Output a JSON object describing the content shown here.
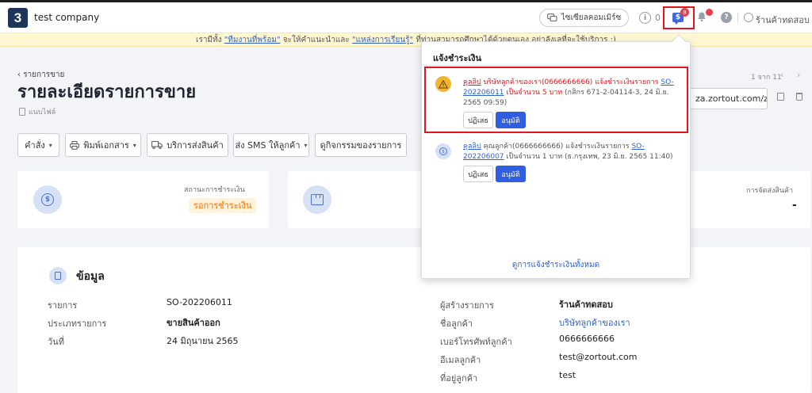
{
  "navbar": {
    "logo_letter": "3",
    "company_name": "test company",
    "consult_label": "ไซเซียลคอมเมิร์ซ",
    "info_count": "0",
    "payment_badge_count": "8",
    "user_name": "ร้านค้าทดสอบ"
  },
  "announcement": {
    "prefix": "เรามีทั้ง ",
    "link1": "\"ทีมงานที่พร้อม\"",
    "middle": " จะให้คำแนะนำและ ",
    "link2": "\"แหล่งการเรียนรู้\"",
    "suffix": " ที่ท่านสามารถศึกษาได้ด้วยตนเอง อย่าลังเลที่จะใช้บริการ :)"
  },
  "page": {
    "breadcrumb": "รายการขาย",
    "title": "รายละเอียดรายการขาย",
    "attach_label": "แนบไฟล์",
    "pager": "1 จาก 11",
    "share_link": "za.zortout.com/zo2"
  },
  "toolbar": {
    "command": "คำสั่ง",
    "print": "พิมพ์เอกสาร",
    "shipping": "บริการส่งสินค้า",
    "sms": "ส่ง SMS ให้ลูกค้า",
    "activity": "ดูกิจกรรมของรายการ"
  },
  "status_cards": {
    "payment_label": "สถานะการชำระเงิน",
    "payment_status": "รอการชำระเงิน",
    "shipping_label": "การจัดส่งสินค้า",
    "shipping_value": "-"
  },
  "info": {
    "title": "ข้อมูล",
    "left": [
      {
        "label": "รายการ",
        "value": "SO-202206011"
      },
      {
        "label": "ประเภทรายการ",
        "value": "ขายสินค้าออก"
      },
      {
        "label": "วันที่",
        "value": "24 มิถุนายน 2565"
      }
    ],
    "right": [
      {
        "label": "ผู้สร้างรายการ",
        "value": "ร้านค้าทดสอบ"
      },
      {
        "label": "ชื่อลูกค้า",
        "value": "บริษัทลูกค้าของเรา"
      },
      {
        "label": "เบอร์โทรศัพท์ลูกค้า",
        "value": "0666666666"
      },
      {
        "label": "อีเมลลูกค้า",
        "value": "test@zortout.com"
      },
      {
        "label": "ที่อยู่ลูกค้า",
        "value": "test"
      }
    ]
  },
  "dropdown": {
    "title": "แจ้งชำระเงิน",
    "notifications": [
      {
        "source": "คุลลิป",
        "text": " บริษัทลูกค้าของเรา(0666666666) แจ้งชำระเงินรายการ ",
        "order": "SO-202206011",
        "amount": " เป็นจำนวน 5 บาท",
        "detail": " (กสิกร 671-2-04114-3, 24 มิ.ย. 2565 09:59)",
        "reject": "ปฏิเสธ",
        "approve": "อนุมัติ"
      },
      {
        "source": "คุลลิป",
        "text": " คุณลูกค้า(0666666666) แจ้งชำระเงินรายการ ",
        "order": "SO-202206007",
        "amount": " เป็นจำนวน 1 บาท",
        "detail": " (ธ.กรุงเทพ, 23 มิ.ย. 2565 11:40)",
        "reject": "ปฏิเสธ",
        "approve": "อนุมัติ"
      }
    ],
    "view_all": "ดูการแจ้งชำระเงินทั้งหมด"
  },
  "colors": {
    "accent": "#2f5ee0",
    "highlight": "#e3141c",
    "warning": "#f3b433",
    "pending": "#f2993a"
  }
}
